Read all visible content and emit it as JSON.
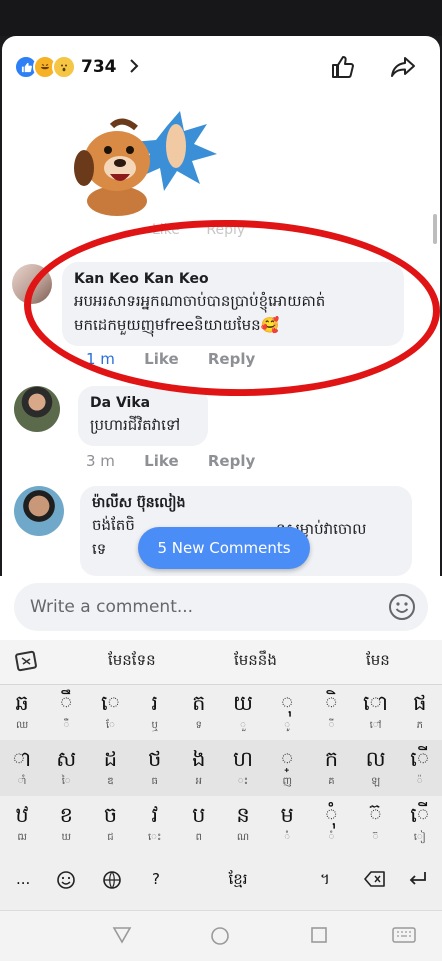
{
  "header": {
    "reaction_count": "734",
    "reactions": [
      {
        "name": "like",
        "color": "#2d7ff5"
      },
      {
        "name": "haha",
        "color": "#f7b125"
      },
      {
        "name": "wow",
        "color": "#f5c544"
      }
    ]
  },
  "ghost_actions": {
    "like": "Like",
    "reply": "Reply"
  },
  "comments": [
    {
      "name": "Kan Keo Kan Keo",
      "lines": [
        "អបអរសាទរអ្នកណាចាប់បានប្រាប់ខ្ញុំអោយគាត់",
        "មកដេកមួយញុមfreeនិយាយមែន🥰"
      ],
      "time": "1 m",
      "like": "Like",
      "reply": "Reply"
    },
    {
      "name": "Da Vika",
      "lines": [
        "ប្រហារជីវិតវាទៅ"
      ],
      "time": "3 m",
      "like": "Like",
      "reply": "Reply"
    },
    {
      "name": "ម៉ាលីស ប៊ុនលៀង",
      "lines": [
        "ចង់តែចិ",
        "ទេ"
      ],
      "partial": "ទសម្លាប់វាចោល"
    }
  ],
  "new_comments_label": "5 New Comments",
  "composer": {
    "placeholder": "Write a comment..."
  },
  "keyboard": {
    "suggestions": [
      "មែនទែន",
      "មែននឹង",
      "មែន"
    ],
    "row1": [
      {
        "k": "ឆ",
        "s": "ឈ"
      },
      {
        "k": "ឹ",
        "s": "ឺ"
      },
      {
        "k": "េ",
        "s": "ែ"
      },
      {
        "k": "រ",
        "s": "ឬ"
      },
      {
        "k": "ត",
        "s": "ទ"
      },
      {
        "k": "យ",
        "s": "ួ"
      },
      {
        "k": "ុ",
        "s": "ូ"
      },
      {
        "k": "ិ",
        "s": "ី"
      },
      {
        "k": "ោ",
        "s": "ៅ"
      },
      {
        "k": "ផ",
        "s": "ភ"
      }
    ],
    "row2": [
      {
        "k": "ា",
        "s": "ាំ"
      },
      {
        "k": "ស",
        "s": "ៃ"
      },
      {
        "k": "ដ",
        "s": "ឌ"
      },
      {
        "k": "ថ",
        "s": "ធ"
      },
      {
        "k": "ង",
        "s": "អ"
      },
      {
        "k": "ហ",
        "s": "ះ"
      },
      {
        "k": "្",
        "s": "ញ"
      },
      {
        "k": "ក",
        "s": "គ"
      },
      {
        "k": "ល",
        "s": "ឡ"
      },
      {
        "k": "ើ",
        "s": "៉"
      }
    ],
    "row3": [
      {
        "k": "ឋ",
        "s": "ឍ"
      },
      {
        "k": "ខ",
        "s": "ឃ"
      },
      {
        "k": "ច",
        "s": "ជ"
      },
      {
        "k": "វ",
        "s": "េះ"
      },
      {
        "k": "ប",
        "s": "ព"
      },
      {
        "k": "ន",
        "s": "ណ"
      },
      {
        "k": "ម",
        "s": "ំ"
      },
      {
        "k": "ុំ",
        "s": "ំ"
      },
      {
        "k": "៊",
        "s": "៊"
      },
      {
        "k": "ើ",
        "s": "ៀ"
      }
    ],
    "bottom": {
      "dots": "...",
      "q": "?",
      "space": "ខ្មែរ",
      "pipe": "។"
    }
  }
}
